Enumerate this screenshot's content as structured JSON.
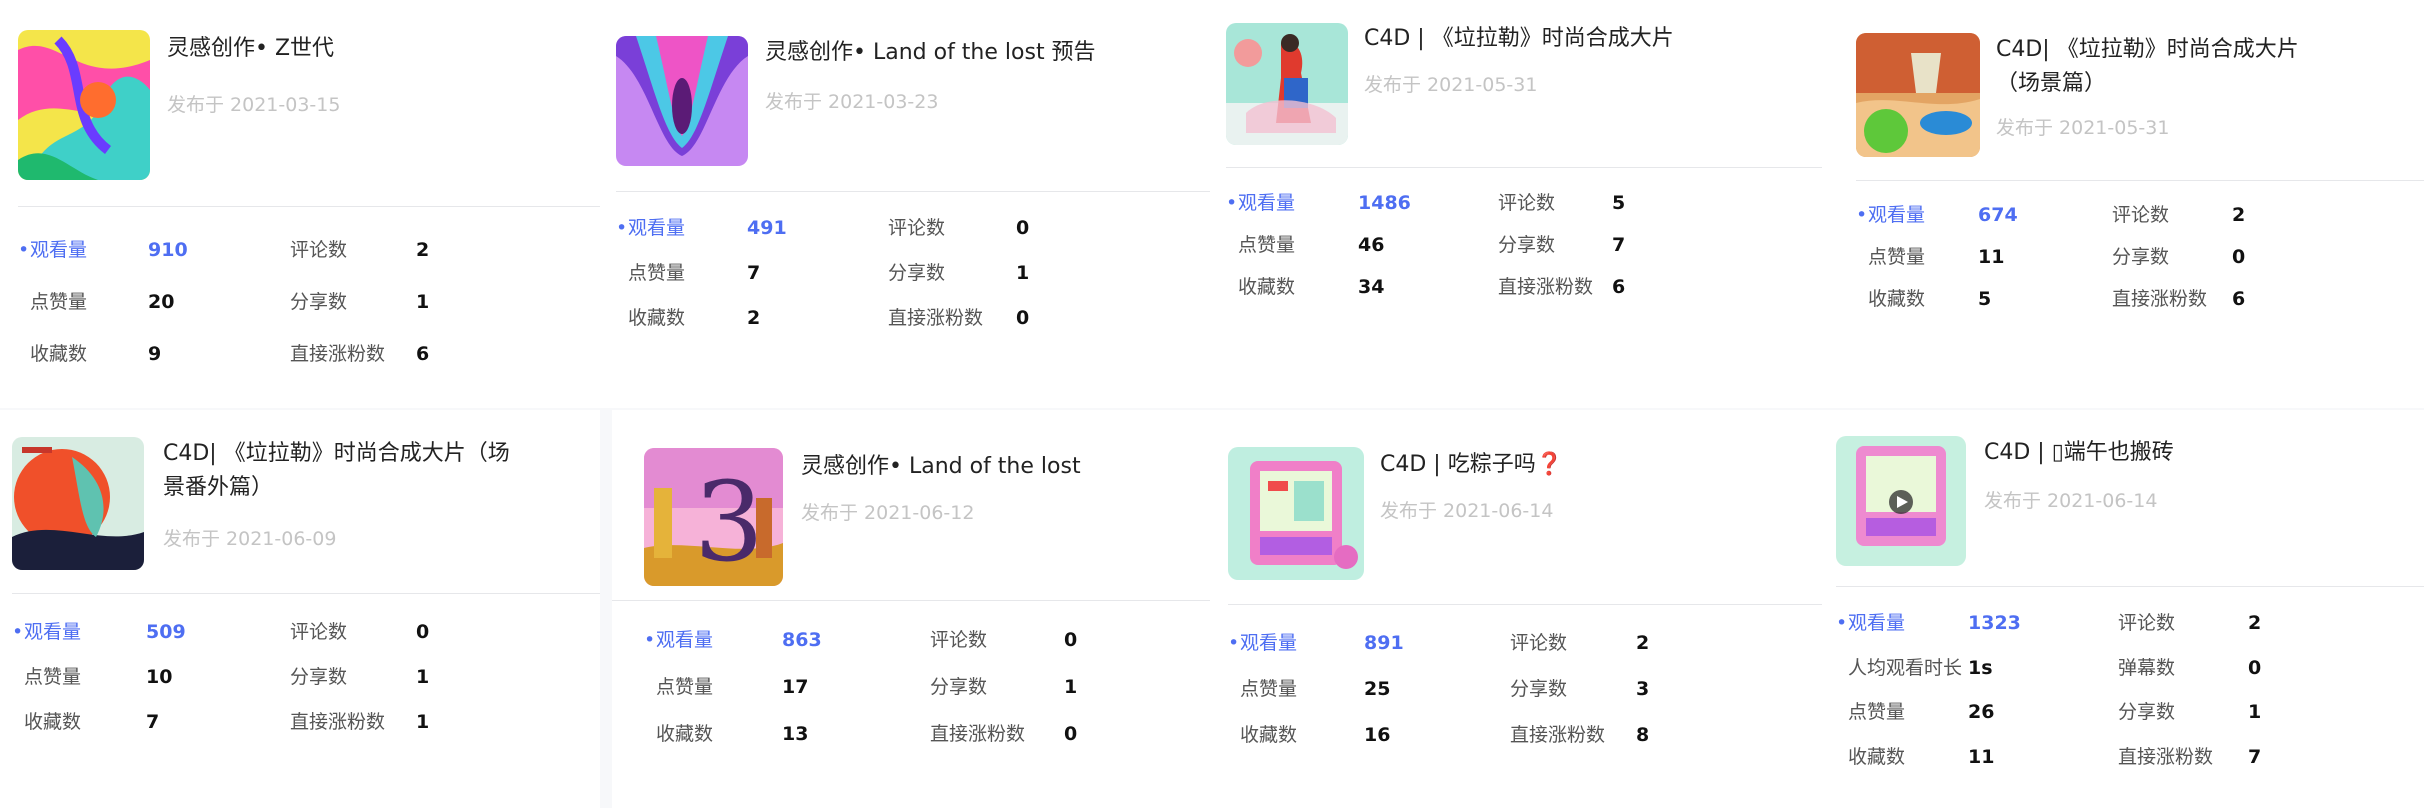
{
  "cards": [
    {
      "title": "灵感创作• Z世代",
      "date": "发布于 2021-03-15",
      "rows": [
        [
          {
            "label": "观看量",
            "value": "910",
            "hl": true
          },
          {
            "label": "评论数",
            "value": "2"
          }
        ],
        [
          {
            "label": "点赞量",
            "value": "20"
          },
          {
            "label": "分享数",
            "value": "1"
          }
        ],
        [
          {
            "label": "收藏数",
            "value": "9"
          },
          {
            "label": "直接涨粉数",
            "value": "6"
          }
        ]
      ]
    },
    {
      "title": "灵感创作• Land of the lost 预告",
      "date": "发布于 2021-03-23",
      "rows": [
        [
          {
            "label": "观看量",
            "value": "491",
            "hl": true
          },
          {
            "label": "评论数",
            "value": "0"
          }
        ],
        [
          {
            "label": "点赞量",
            "value": "7"
          },
          {
            "label": "分享数",
            "value": "1"
          }
        ],
        [
          {
            "label": "收藏数",
            "value": "2"
          },
          {
            "label": "直接涨粉数",
            "value": "0"
          }
        ]
      ]
    },
    {
      "title": "C4D | 《垃拉勒》时尚合成大片",
      "date": "发布于 2021-05-31",
      "rows": [
        [
          {
            "label": "观看量",
            "value": "1486",
            "hl": true
          },
          {
            "label": "评论数",
            "value": "5"
          }
        ],
        [
          {
            "label": "点赞量",
            "value": "46"
          },
          {
            "label": "分享数",
            "value": "7"
          }
        ],
        [
          {
            "label": "收藏数",
            "value": "34"
          },
          {
            "label": "直接涨粉数",
            "value": "6"
          }
        ]
      ]
    },
    {
      "title": "C4D| 《垃拉勒》时尚合成大片（场景篇）",
      "date": "发布于 2021-05-31",
      "rows": [
        [
          {
            "label": "观看量",
            "value": "674",
            "hl": true
          },
          {
            "label": "评论数",
            "value": "2"
          }
        ],
        [
          {
            "label": "点赞量",
            "value": "11"
          },
          {
            "label": "分享数",
            "value": "0"
          }
        ],
        [
          {
            "label": "收藏数",
            "value": "5"
          },
          {
            "label": "直接涨粉数",
            "value": "6"
          }
        ]
      ]
    },
    {
      "title": "C4D| 《垃拉勒》时尚合成大片（场景番外篇）",
      "date": "发布于 2021-06-09",
      "rows": [
        [
          {
            "label": "观看量",
            "value": "509",
            "hl": true
          },
          {
            "label": "评论数",
            "value": "0"
          }
        ],
        [
          {
            "label": "点赞量",
            "value": "10"
          },
          {
            "label": "分享数",
            "value": "1"
          }
        ],
        [
          {
            "label": "收藏数",
            "value": "7"
          },
          {
            "label": "直接涨粉数",
            "value": "1"
          }
        ]
      ]
    },
    {
      "title": "灵感创作• Land of the lost",
      "date": "发布于 2021-06-12",
      "rows": [
        [
          {
            "label": "观看量",
            "value": "863",
            "hl": true
          },
          {
            "label": "评论数",
            "value": "0"
          }
        ],
        [
          {
            "label": "点赞量",
            "value": "17"
          },
          {
            "label": "分享数",
            "value": "1"
          }
        ],
        [
          {
            "label": "收藏数",
            "value": "13"
          },
          {
            "label": "直接涨粉数",
            "value": "0"
          }
        ]
      ]
    },
    {
      "title": "C4D | 吃粽子吗❓",
      "date": "发布于 2021-06-14",
      "rows": [
        [
          {
            "label": "观看量",
            "value": "891",
            "hl": true
          },
          {
            "label": "评论数",
            "value": "2"
          }
        ],
        [
          {
            "label": "点赞量",
            "value": "25"
          },
          {
            "label": "分享数",
            "value": "3"
          }
        ],
        [
          {
            "label": "收藏数",
            "value": "16"
          },
          {
            "label": "直接涨粉数",
            "value": "8"
          }
        ]
      ]
    },
    {
      "title": "C4D | ▯端午也搬砖",
      "date": "发布于 2021-06-14",
      "rows": [
        [
          {
            "label": "观看量",
            "value": "1323",
            "hl": true
          },
          {
            "label": "评论数",
            "value": "2"
          }
        ],
        [
          {
            "label": "人均观看时长",
            "value": "1s"
          },
          {
            "label": "弹幕数",
            "value": "0"
          }
        ],
        [
          {
            "label": "点赞量",
            "value": "26"
          },
          {
            "label": "分享数",
            "value": "1"
          }
        ],
        [
          {
            "label": "收藏数",
            "value": "11"
          },
          {
            "label": "直接涨粉数",
            "value": "7"
          }
        ]
      ]
    }
  ]
}
